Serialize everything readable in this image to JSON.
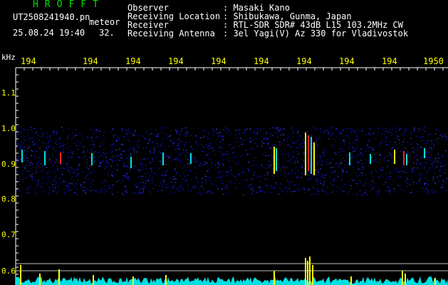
{
  "header": {
    "brand": "HROFFT",
    "filename": "UT2508241940.pn",
    "tag": "meteor",
    "datetime": "25.08.24 19:40",
    "level": "32."
  },
  "info": {
    "observer_label": "Observer",
    "observer_value": ": Masaki Kano",
    "location_label": "Receiving Location",
    "location_value": ": Shibukawa, Gunma, Japan",
    "receiver_label": "Receiver",
    "receiver_value": ": RTL-SDR SDR# 43dB L15 103.2MHz CW",
    "antenna_label": "Receiving Antenna",
    "antenna_value": ": 3el Yagi(V) Az 330 for Vladivostok"
  },
  "x_axis": {
    "ticks": [
      "194",
      "194",
      "194",
      "194",
      "194",
      "194",
      "194",
      "194",
      "194",
      "1950"
    ]
  },
  "y_axis": {
    "unit": "kHz",
    "ticks": [
      "1.1",
      "1.0",
      "0.9",
      "0.8",
      "0.7",
      "0.6"
    ]
  },
  "colors": {
    "noise_blue": "#1a1aff",
    "signal_cyan": "#00e0e0",
    "signal_yellow": "#ffff00",
    "signal_red": "#ff2020",
    "green": "#00e000"
  }
}
